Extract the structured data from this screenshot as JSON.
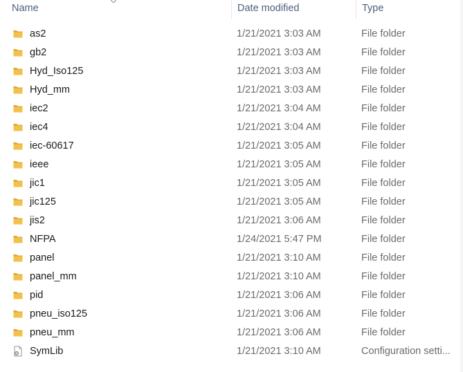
{
  "columns": {
    "name": "Name",
    "date_modified": "Date modified",
    "type": "Type"
  },
  "rows": [
    {
      "name": "as2",
      "date": "1/21/2021 3:03 AM",
      "type": "File folder",
      "icon": "folder-icon"
    },
    {
      "name": "gb2",
      "date": "1/21/2021 3:03 AM",
      "type": "File folder",
      "icon": "folder-icon"
    },
    {
      "name": "Hyd_Iso125",
      "date": "1/21/2021 3:03 AM",
      "type": "File folder",
      "icon": "folder-icon"
    },
    {
      "name": "Hyd_mm",
      "date": "1/21/2021 3:03 AM",
      "type": "File folder",
      "icon": "folder-icon"
    },
    {
      "name": "iec2",
      "date": "1/21/2021 3:04 AM",
      "type": "File folder",
      "icon": "folder-icon"
    },
    {
      "name": "iec4",
      "date": "1/21/2021 3:04 AM",
      "type": "File folder",
      "icon": "folder-icon"
    },
    {
      "name": "iec-60617",
      "date": "1/21/2021 3:05 AM",
      "type": "File folder",
      "icon": "folder-icon"
    },
    {
      "name": "ieee",
      "date": "1/21/2021 3:05 AM",
      "type": "File folder",
      "icon": "folder-icon"
    },
    {
      "name": "jic1",
      "date": "1/21/2021 3:05 AM",
      "type": "File folder",
      "icon": "folder-icon"
    },
    {
      "name": "jic125",
      "date": "1/21/2021 3:05 AM",
      "type": "File folder",
      "icon": "folder-icon"
    },
    {
      "name": "jis2",
      "date": "1/21/2021 3:06 AM",
      "type": "File folder",
      "icon": "folder-icon"
    },
    {
      "name": "NFPA",
      "date": "1/24/2021 5:47 PM",
      "type": "File folder",
      "icon": "folder-icon"
    },
    {
      "name": "panel",
      "date": "1/21/2021 3:10 AM",
      "type": "File folder",
      "icon": "folder-icon"
    },
    {
      "name": "panel_mm",
      "date": "1/21/2021 3:10 AM",
      "type": "File folder",
      "icon": "folder-icon"
    },
    {
      "name": "pid",
      "date": "1/21/2021 3:06 AM",
      "type": "File folder",
      "icon": "folder-icon"
    },
    {
      "name": "pneu_iso125",
      "date": "1/21/2021 3:06 AM",
      "type": "File folder",
      "icon": "folder-icon"
    },
    {
      "name": "pneu_mm",
      "date": "1/21/2021 3:06 AM",
      "type": "File folder",
      "icon": "folder-icon"
    },
    {
      "name": "SymLib",
      "date": "1/21/2021 3:10 AM",
      "type": "Configuration setti...",
      "icon": "config-file-icon"
    }
  ],
  "colors": {
    "folder_body": "#f2c04b",
    "folder_tab": "#dca634",
    "header_text": "#4c607a",
    "secondary_text": "#6b6b6b"
  }
}
